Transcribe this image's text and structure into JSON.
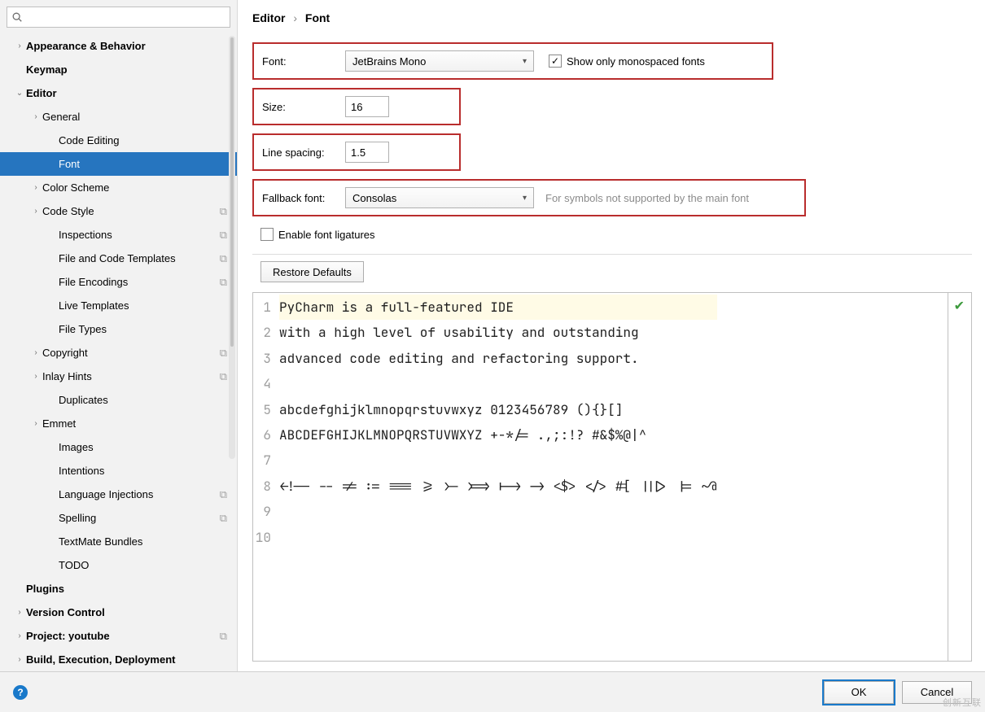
{
  "search": {
    "placeholder": ""
  },
  "breadcrumb": {
    "a": "Editor",
    "b": "Font"
  },
  "sidebar": {
    "items": [
      {
        "label": "Appearance & Behavior",
        "lvl": 0,
        "arrow": ">",
        "bold": true
      },
      {
        "label": "Keymap",
        "lvl": 0,
        "arrow": "",
        "bold": true
      },
      {
        "label": "Editor",
        "lvl": 0,
        "arrow": "v",
        "bold": true
      },
      {
        "label": "General",
        "lvl": 1,
        "arrow": ">"
      },
      {
        "label": "Code Editing",
        "lvl": 2,
        "arrow": ""
      },
      {
        "label": "Font",
        "lvl": 2,
        "arrow": "",
        "selected": true
      },
      {
        "label": "Color Scheme",
        "lvl": 1,
        "arrow": ">"
      },
      {
        "label": "Code Style",
        "lvl": 1,
        "arrow": ">",
        "copy": true
      },
      {
        "label": "Inspections",
        "lvl": 2,
        "arrow": "",
        "copy": true
      },
      {
        "label": "File and Code Templates",
        "lvl": 2,
        "arrow": "",
        "copy": true
      },
      {
        "label": "File Encodings",
        "lvl": 2,
        "arrow": "",
        "copy": true
      },
      {
        "label": "Live Templates",
        "lvl": 2,
        "arrow": ""
      },
      {
        "label": "File Types",
        "lvl": 2,
        "arrow": ""
      },
      {
        "label": "Copyright",
        "lvl": 1,
        "arrow": ">",
        "copy": true
      },
      {
        "label": "Inlay Hints",
        "lvl": 1,
        "arrow": ">",
        "copy": true
      },
      {
        "label": "Duplicates",
        "lvl": 2,
        "arrow": ""
      },
      {
        "label": "Emmet",
        "lvl": 1,
        "arrow": ">"
      },
      {
        "label": "Images",
        "lvl": 2,
        "arrow": ""
      },
      {
        "label": "Intentions",
        "lvl": 2,
        "arrow": ""
      },
      {
        "label": "Language Injections",
        "lvl": 2,
        "arrow": "",
        "copy": true
      },
      {
        "label": "Spelling",
        "lvl": 2,
        "arrow": "",
        "copy": true
      },
      {
        "label": "TextMate Bundles",
        "lvl": 2,
        "arrow": ""
      },
      {
        "label": "TODO",
        "lvl": 2,
        "arrow": ""
      },
      {
        "label": "Plugins",
        "lvl": 0,
        "arrow": "",
        "bold": true
      },
      {
        "label": "Version Control",
        "lvl": 0,
        "arrow": ">",
        "bold": true
      },
      {
        "label": "Project: youtube",
        "lvl": 0,
        "arrow": ">",
        "bold": true,
        "copy": true
      },
      {
        "label": "Build, Execution, Deployment",
        "lvl": 0,
        "arrow": ">",
        "bold": true
      }
    ]
  },
  "form": {
    "font_label": "Font:",
    "font_value": "JetBrains Mono",
    "show_mono_label": "Show only monospaced fonts",
    "show_mono_checked": true,
    "size_label": "Size:",
    "size_value": "16",
    "spacing_label": "Line spacing:",
    "spacing_value": "1.5",
    "fallback_label": "Fallback font:",
    "fallback_value": "Consolas",
    "fallback_hint": "For symbols not supported by the main font",
    "ligatures_label": "Enable font ligatures",
    "ligatures_checked": false,
    "restore_label": "Restore Defaults"
  },
  "preview": {
    "lines": [
      "PyCharm is a full-featured IDE",
      "with a high level of usability and outstanding",
      "advanced code editing and refactoring support.",
      "",
      "abcdefghijklmnopqrstuvwxyz 0123456789 (){}[]",
      "ABCDEFGHIJKLMNOPQRSTUVWXYZ +-*/= .,;:!? #&$%@|^",
      "",
      "<!-- -- != := === >= >- >=> |-> -> <$> </> #[ |||> |= ~@",
      "",
      ""
    ]
  },
  "footer": {
    "ok": "OK",
    "cancel": "Cancel"
  },
  "watermark": "创新互联"
}
